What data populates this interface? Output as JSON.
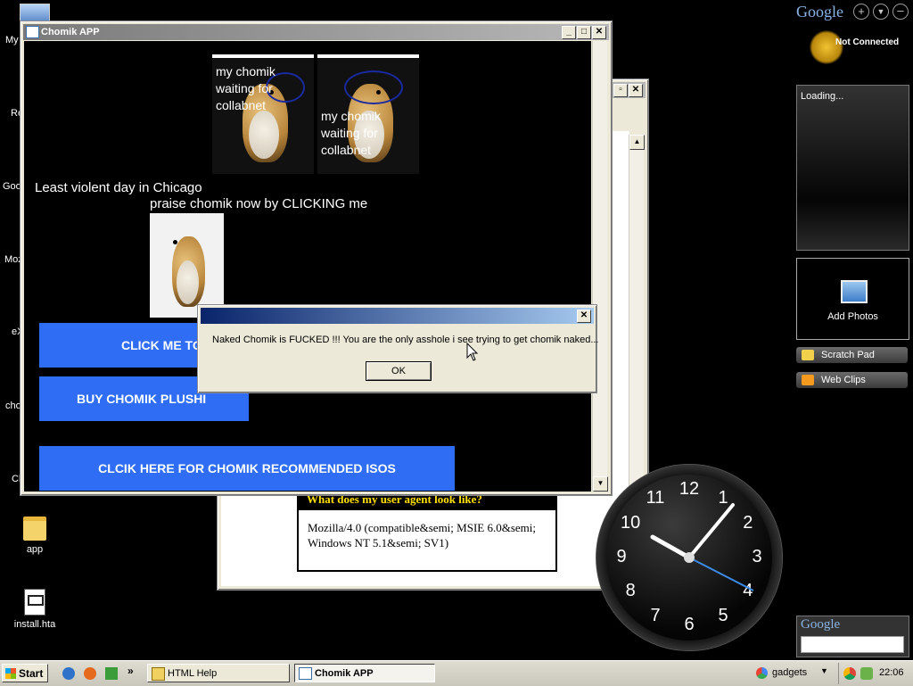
{
  "desktop": {
    "icons": [
      {
        "label": "app"
      },
      {
        "label": "install.hta"
      }
    ],
    "cut_labels": [
      "My",
      "Re",
      "Goo",
      "Moz",
      "eX",
      "cho",
      "Cl"
    ]
  },
  "chomik_window": {
    "title": "Chomik APP",
    "caption_1": "my chomik waiting for collabnet",
    "caption_2": "my chomik waiting for collabnet",
    "text_chicago": "Least violent day in Chicago",
    "text_praise": "praise chomik now by CLICKING me",
    "btn_click_me": "CLICK ME TO",
    "btn_buy": "BUY CHOMIK PLUSHI",
    "btn_isos": "CLCIK HERE FOR CHOMIK RECOMMENDED ISOS"
  },
  "dialog": {
    "message": "Naked Chomik is FUCKED !!! You are the only asshole i see trying to get chomik naked...",
    "ok_label": "OK"
  },
  "back_window": {
    "heading": "What does my user agent look like?",
    "user_agent": "Mozilla/4.0 (compatible&semi; MSIE 6.0&semi; Windows NT 5.1&semi; SV1)"
  },
  "google_sidebar": {
    "logo": "Google",
    "status": "Not Connected",
    "loading": "Loading...",
    "add_photos": "Add Photos",
    "scratch_pad": "Scratch Pad",
    "web_clips": "Web Clips",
    "search_logo": "Google"
  },
  "clock": {
    "numbers": [
      "12",
      "1",
      "2",
      "3",
      "4",
      "5",
      "6",
      "7",
      "8",
      "9",
      "10",
      "11"
    ],
    "time": "22:06"
  },
  "taskbar": {
    "start": "Start",
    "tasks": [
      {
        "label": "HTML Help"
      },
      {
        "label": "Chomik APP"
      }
    ],
    "gadgets": "gadgets",
    "time": "22:06"
  }
}
